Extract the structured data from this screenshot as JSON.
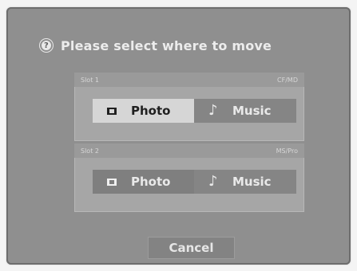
{
  "dialog": {
    "title": "Please select where to move",
    "title_icon": "question-icon",
    "cancel_label": "Cancel"
  },
  "slots": [
    {
      "label": "Slot 1",
      "card": "CF/MD",
      "photo_label": "Photo",
      "music_label": "Music"
    },
    {
      "label": "Slot 2",
      "card": "MS/Pro",
      "photo_label": "Photo",
      "music_label": "Music"
    }
  ],
  "icons": {
    "photo": "photo-icon",
    "music": "music-note-icon"
  },
  "colors": {
    "dialog_bg": "#8f8f8f",
    "selected_bg": "#d6d6d6",
    "button_bg": "#7f7f7f"
  }
}
